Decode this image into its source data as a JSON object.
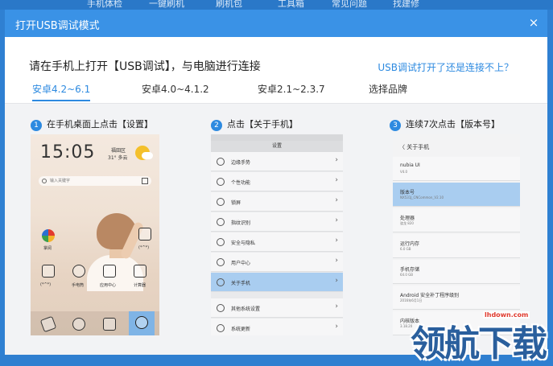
{
  "topnav": {
    "items": [
      "手机体检",
      "一键刷机",
      "刷机包",
      "工具箱",
      "常见问题",
      "找建修"
    ]
  },
  "dialog": {
    "title": "打开USB调试模式",
    "close_glyph": "×",
    "headline": "请在手机上打开【USB调试】，与电脑进行连接",
    "help_link": "USB调试打开了还是连接不上？",
    "tabs": [
      {
        "label": "安卓4.2~6.1",
        "active": true
      },
      {
        "label": "安卓4.0~4.1.2",
        "active": false
      },
      {
        "label": "安卓2.1~2.3.7",
        "active": false
      },
      {
        "label": "选择品牌",
        "active": false
      }
    ]
  },
  "steps": [
    {
      "num": "1",
      "text": "在手机桌面上点击【设置】"
    },
    {
      "num": "2",
      "text": "点击【关于手机】"
    },
    {
      "num": "3",
      "text": "连续7次点击【版本号】"
    }
  ],
  "phone1": {
    "clock": "15:05",
    "city": "福田区",
    "temp": "31° 多云",
    "search_placeholder": "输入关键字",
    "apps": [
      "(*^*)",
      "手电筒",
      "应用中心",
      "计算器"
    ],
    "app_top_label": "(*^*)",
    "ball_label": "掌阅"
  },
  "phone2": {
    "header": "设置",
    "rows": [
      {
        "label": "边缘手势",
        "selected": false
      },
      {
        "label": "个性功能",
        "selected": false
      },
      {
        "label": "锁屏",
        "selected": false
      },
      {
        "label": "指纹识别",
        "selected": false
      },
      {
        "label": "安全与隐私",
        "selected": false
      },
      {
        "label": "用户中心",
        "selected": false
      },
      {
        "label": "关于手机",
        "selected": true
      },
      {
        "label": "其他系统设置",
        "selected": false
      },
      {
        "label": "系统更新",
        "selected": false
      }
    ]
  },
  "phone3": {
    "header": "〈 关于手机",
    "rows": [
      {
        "label": "nubia UI",
        "value": "V4.0",
        "selected": false
      },
      {
        "label": "版本号",
        "value": "NX531J_CNCommon_V2.10",
        "selected": true
      },
      {
        "label": "处理器",
        "value": "骁龙 820",
        "selected": false
      },
      {
        "label": "运行内存",
        "value": "6.0 GB",
        "selected": false
      },
      {
        "label": "手机存储",
        "value": "64.0 GB",
        "selected": false
      },
      {
        "label": "Android 安全补丁程序级别",
        "value": "2016年6月1日",
        "selected": false
      },
      {
        "label": "内核版本",
        "value": "3.18.20",
        "selected": false
      }
    ]
  },
  "watermark": {
    "text": "领航下载",
    "url": "lhdown.com"
  }
}
